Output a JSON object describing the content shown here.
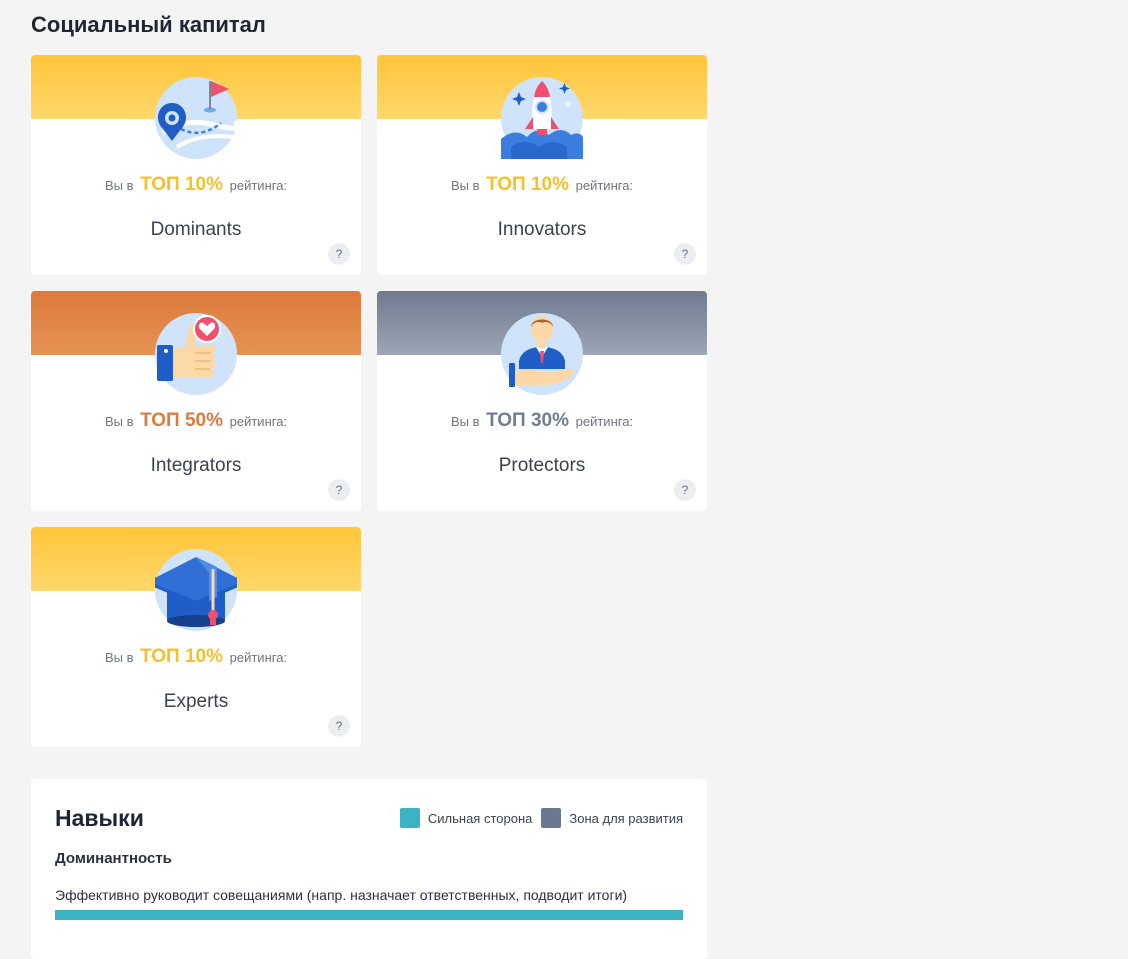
{
  "page": {
    "title": "Социальный капитал"
  },
  "cards": [
    {
      "rank_prefix": "Вы в",
      "rank_top": "ТОП 10%",
      "rank_suffix": "рейтинга:",
      "name": "Dominants",
      "help": "?",
      "icon": "map-pin-flag-icon"
    },
    {
      "rank_prefix": "Вы в",
      "rank_top": "ТОП 10%",
      "rank_suffix": "рейтинга:",
      "name": "Innovators",
      "help": "?",
      "icon": "rocket-icon"
    },
    {
      "rank_prefix": "Вы в",
      "rank_top": "ТОП 50%",
      "rank_suffix": "рейтинга:",
      "name": "Integrators",
      "help": "?",
      "icon": "thumbs-up-heart-icon"
    },
    {
      "rank_prefix": "Вы в",
      "rank_top": "ТОП 30%",
      "rank_suffix": "рейтинга:",
      "name": "Protectors",
      "help": "?",
      "icon": "person-hand-icon"
    },
    {
      "rank_prefix": "Вы в",
      "rank_top": "ТОП 10%",
      "rank_suffix": "рейтинга:",
      "name": "Experts",
      "help": "?",
      "icon": "graduation-cap-icon"
    }
  ],
  "colors": {
    "gold": "#f6bf2d",
    "orange": "#df7b3f",
    "slate": "#727d93",
    "strength": "#3bb3c3",
    "growth": "#6b7892"
  },
  "skills": {
    "title": "Навыки",
    "legend": {
      "strength": "Сильная сторона",
      "growth": "Зона для развития"
    },
    "group": "Доминантность",
    "items": [
      {
        "text": "Эффективно руководит совещаниями (напр. назначает ответственных, подводит итоги)",
        "level": 1.0,
        "kind": "strength"
      }
    ]
  }
}
